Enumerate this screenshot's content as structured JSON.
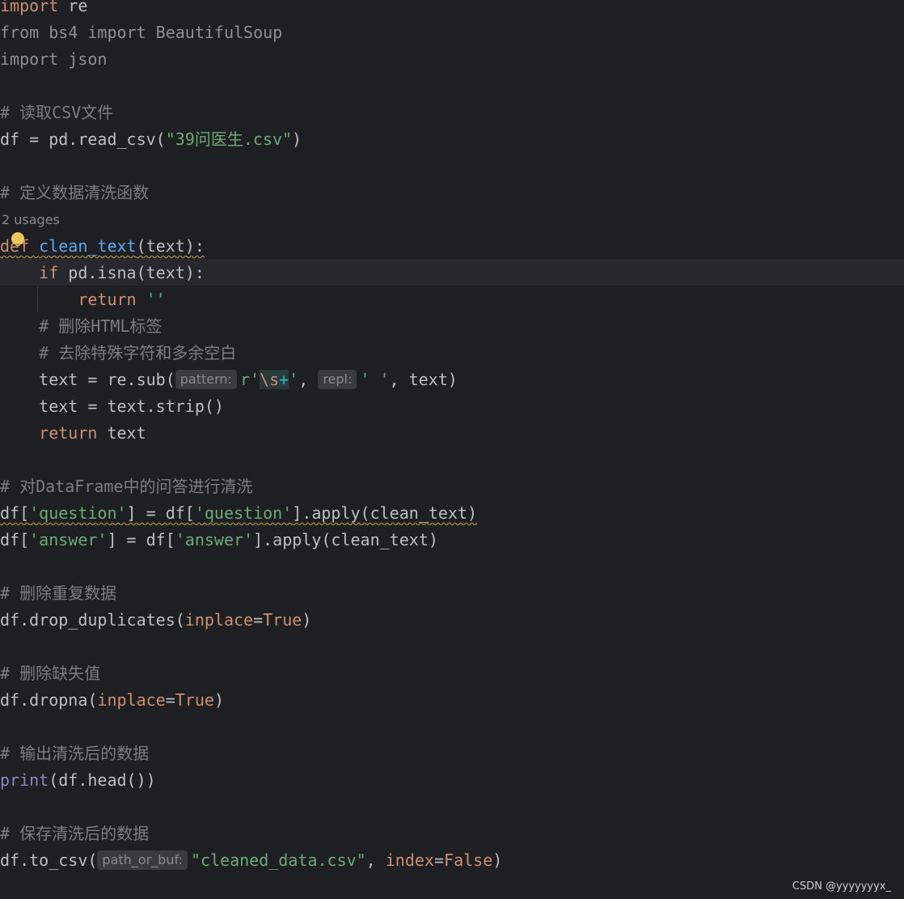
{
  "editor": {
    "lines": {
      "l1": {
        "kw": "import",
        "rest": " re"
      },
      "l2": {
        "text": "from bs4 import BeautifulSoup"
      },
      "l3": {
        "text": "import json"
      },
      "l5": {
        "text": "# 读取CSV文件"
      },
      "l6": {
        "a": "df = pd.read_csv(",
        "str": "\"39问医生.csv\"",
        "b": ")"
      },
      "l8": {
        "text": "# 定义数据清洗函数"
      },
      "usages": "2 usages",
      "l10": {
        "kw": "def",
        "fn": "clean_text",
        "rest": "(text):"
      },
      "l11": {
        "indent": "    ",
        "kw": "if",
        "rest": " pd.isna(text):"
      },
      "l12": {
        "indent": "        ",
        "kw": "return",
        "str": " ''"
      },
      "l13": {
        "indent": "    ",
        "text": "# 删除HTML标签"
      },
      "l14": {
        "indent": "    ",
        "text": "# 去除特殊字符和多余空白"
      },
      "l15": {
        "indent": "    ",
        "a": "text = re.sub(",
        "hint1": "pattern:",
        "str_r": "r'",
        "esc": "\\s",
        "plus": "+",
        "str_close": "'",
        "comma": ", ",
        "hint2": "repl:",
        "str2": "' '",
        "b": ", text)"
      },
      "l16": {
        "indent": "    ",
        "text": "text = text.strip()"
      },
      "l17": {
        "indent": "    ",
        "kw": "return",
        "rest": " text"
      },
      "l19": {
        "text": "# 对DataFrame中的问答进行清洗"
      },
      "l20": {
        "a": "df[",
        "s1": "'question'",
        "b": "] = df[",
        "s2": "'question'",
        "c": "].apply(clean_text)"
      },
      "l21": {
        "a": "df[",
        "s1": "'answer'",
        "b": "] = df[",
        "s2": "'answer'",
        "c": "].apply(clean_text)"
      },
      "l23": {
        "text": "# 删除重复数据"
      },
      "l24": {
        "a": "df.drop_duplicates(",
        "param": "inplace",
        "eq": "=",
        "val": "True",
        "b": ")"
      },
      "l26": {
        "text": "# 删除缺失值"
      },
      "l27": {
        "a": "df.dropna(",
        "param": "inplace",
        "eq": "=",
        "val": "True",
        "b": ")"
      },
      "l29": {
        "text": "# 输出清洗后的数据"
      },
      "l30": {
        "builtin": "print",
        "rest": "(df.head())"
      },
      "l32": {
        "text": "# 保存清洗后的数据"
      },
      "l33": {
        "a": "df.to_csv(",
        "hint": "path_or_buf:",
        "str": "\"cleaned_data.csv\"",
        "b": ", ",
        "param": "index",
        "eq": "=",
        "val": "False",
        "c": ")"
      }
    }
  },
  "watermark": "CSDN @yyyyyyyx_",
  "colors": {
    "background": "#1e1f22",
    "keyword": "#cf8e6d",
    "function": "#56a8f5",
    "string": "#6aab73",
    "comment": "#7a7e85",
    "builtin": "#8888c6",
    "text": "#bcbec4"
  },
  "icons": [
    "intention-bulb-icon"
  ]
}
